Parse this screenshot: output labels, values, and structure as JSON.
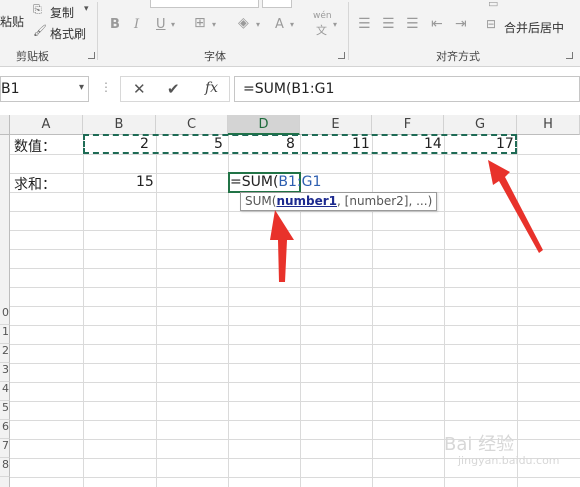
{
  "ribbon": {
    "paste_label": "粘贴",
    "copy_label": "复制",
    "format_painter_label": "格式刷",
    "clipboard_group": "剪贴板",
    "font_group": "字体",
    "alignment_group": "对齐方式",
    "merge_center_label": "合并后居中",
    "bold": "B",
    "italic": "I",
    "underline": "U",
    "font_color_letter": "A",
    "wen_top": "wén",
    "wen_bottom": "文"
  },
  "formula_bar": {
    "name_box": "B1",
    "cancel_icon": "✕",
    "enter_icon": "✔",
    "fx_label": "fx",
    "formula": "=SUM(B1:G1"
  },
  "columns": [
    "A",
    "B",
    "C",
    "D",
    "E",
    "F",
    "G",
    "H"
  ],
  "active_column": "D",
  "rows": {
    "row1_label": "数值：",
    "row1_values": [
      "2",
      "5",
      "8",
      "11",
      "14",
      "17"
    ],
    "row3_label": "求和：",
    "row3_b": "15",
    "row3_d_prefix": "=SUM(",
    "row3_d_ref": "B1:G1"
  },
  "row_header_fragments": [
    "0",
    "1",
    "2",
    "3",
    "4",
    "5",
    "6",
    "7",
    "8"
  ],
  "tooltip": {
    "func": "SUM(",
    "arg_active": "number1",
    "rest": ", [number2], ...)"
  },
  "colors": {
    "accent_green": "#217346",
    "arrow_red": "#e8322b",
    "marquee": "#1e6b55"
  },
  "watermark": "Bai 经验",
  "watermark_url": "jingyan.baidu.com"
}
